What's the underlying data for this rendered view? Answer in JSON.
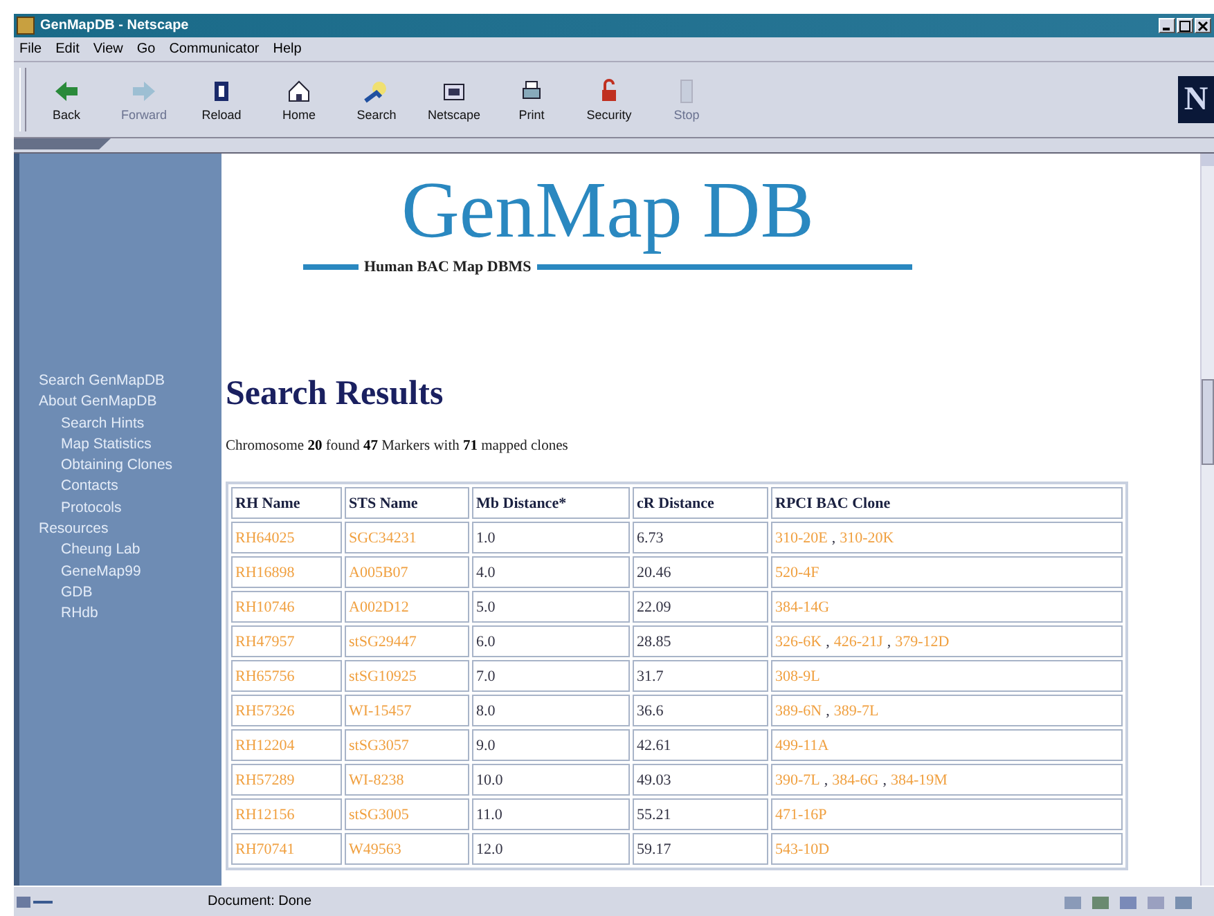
{
  "window": {
    "title": "GenMapDB - Netscape"
  },
  "menu": [
    "File",
    "Edit",
    "View",
    "Go",
    "Communicator",
    "Help"
  ],
  "toolbar": [
    {
      "label": "Back",
      "disabled": false
    },
    {
      "label": "Forward",
      "disabled": true
    },
    {
      "label": "Reload",
      "disabled": false
    },
    {
      "label": "Home",
      "disabled": false
    },
    {
      "label": "Search",
      "disabled": false
    },
    {
      "label": "Netscape",
      "disabled": false
    },
    {
      "label": "Print",
      "disabled": false
    },
    {
      "label": "Security",
      "disabled": false
    },
    {
      "label": "Stop",
      "disabled": true
    }
  ],
  "throbber": "N",
  "sidebar": {
    "items": [
      {
        "label": "Search GenMapDB"
      },
      {
        "label": "About GenMapDB",
        "children": [
          {
            "label": "Search Hints"
          },
          {
            "label": "Map Statistics"
          },
          {
            "label": "Obtaining Clones"
          },
          {
            "label": "Contacts"
          },
          {
            "label": "Protocols"
          }
        ]
      },
      {
        "label": "Resources",
        "children": [
          {
            "label": "Cheung Lab"
          },
          {
            "label": "GeneMap99"
          },
          {
            "label": "GDB"
          },
          {
            "label": "RHdb"
          }
        ]
      }
    ]
  },
  "logo": {
    "title": "GenMap DB",
    "subtitle": "Human BAC Map DBMS"
  },
  "heading": "Search Results",
  "summary": "Chromosome **20** found **47** Markers with **71** mapped clones",
  "table": {
    "columns": [
      "RH Name",
      "STS Name",
      "Mb Distance*",
      "cR Distance",
      "RPCI BAC Clone"
    ],
    "rows": [
      {
        "rh_name": "RH64025",
        "sts_name": "SGC34231",
        "mb_distance": "1.0",
        "cr_distance": "6.73",
        "clones": [
          {
            "label": "310-20E"
          },
          {
            "separator": ",",
            "label": "310-20K"
          }
        ]
      },
      {
        "rh_name": "RH16898",
        "sts_name": "A005B07",
        "mb_distance": "4.0",
        "cr_distance": "20.46",
        "clones": [
          {
            "label": "520-4F"
          }
        ]
      },
      {
        "rh_name": "RH10746",
        "sts_name": "A002D12",
        "mb_distance": "5.0",
        "cr_distance": "22.09",
        "clones": [
          {
            "label": "384-14G"
          }
        ]
      },
      {
        "rh_name": "RH47957",
        "sts_name": "stSG29447",
        "mb_distance": "6.0",
        "cr_distance": "28.85",
        "clones": [
          {
            "label": "326-6K"
          },
          {
            "separator": ",",
            "label": "426-21J"
          },
          {
            "separator": ",",
            "label": "379-12D"
          }
        ]
      },
      {
        "rh_name": "RH65756",
        "sts_name": "stSG10925",
        "mb_distance": "7.0",
        "cr_distance": "31.7",
        "clones": [
          {
            "label": "308-9L"
          }
        ]
      },
      {
        "rh_name": "RH57326",
        "sts_name": "WI-15457",
        "mb_distance": "8.0",
        "cr_distance": "36.6",
        "clones": [
          {
            "label": "389-6N"
          },
          {
            "separator": ",",
            "label": "389-7L"
          }
        ]
      },
      {
        "rh_name": "RH12204",
        "sts_name": "stSG3057",
        "mb_distance": "9.0",
        "cr_distance": "42.61",
        "clones": [
          {
            "label": "499-11A"
          }
        ]
      },
      {
        "rh_name": "RH57289",
        "sts_name": "WI-8238",
        "mb_distance": "10.0",
        "cr_distance": "49.03",
        "clones": [
          {
            "label": "390-7L"
          },
          {
            "separator": ",",
            "label": "384-6G"
          },
          {
            "separator": ",",
            "label": "384-19M"
          }
        ]
      },
      {
        "rh_name": "RH12156",
        "sts_name": "stSG3005",
        "mb_distance": "11.0",
        "cr_distance": "55.21",
        "clones": [
          {
            "label": "471-16P"
          }
        ]
      },
      {
        "rh_name": "RH70741",
        "sts_name": "W49563",
        "mb_distance": "12.0",
        "cr_distance": "59.17",
        "clones": [
          {
            "label": "543-10D"
          }
        ]
      }
    ]
  },
  "status_bar": {
    "text": "Document: Done"
  }
}
